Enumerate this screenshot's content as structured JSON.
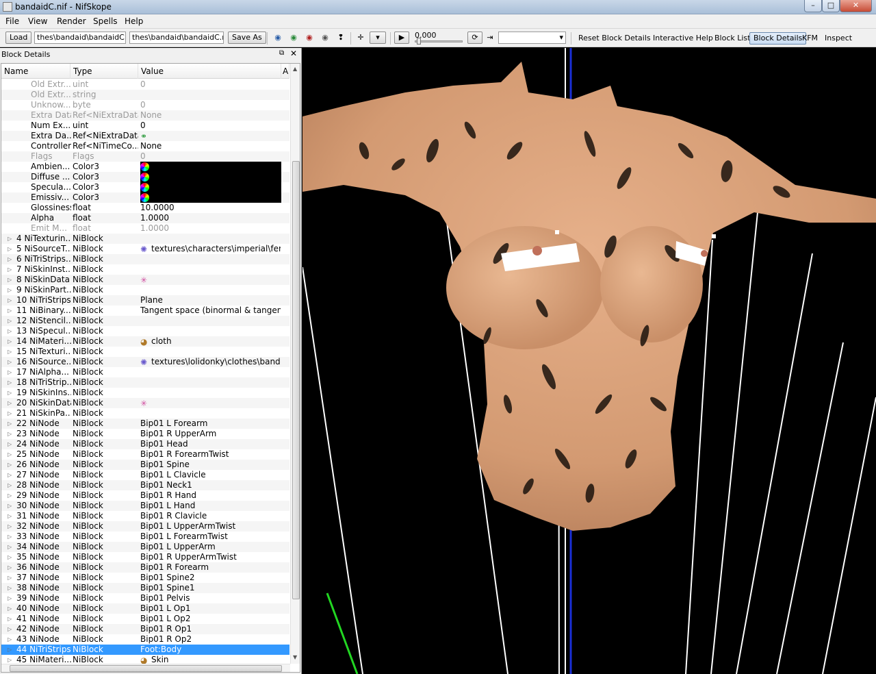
{
  "window": {
    "title": "bandaidC.nif - NifSkope",
    "min": "–",
    "max": "□",
    "close": "✕"
  },
  "menu": [
    "File",
    "View",
    "Render",
    "Spells",
    "Help"
  ],
  "toolbar": {
    "load": "Load",
    "load_path": "thes\\bandaid\\bandaidC.nif",
    "save_path": "thes\\bandaid\\bandaidC.nif",
    "save_as": "Save As",
    "time_value": "0.000",
    "right_buttons": [
      "Reset Block Details",
      "Interactive Help",
      "Block List",
      "Block Details",
      "KFM",
      "Inspect"
    ],
    "active_right": "Block Details"
  },
  "dock": {
    "title": "Block Details",
    "columns": [
      "Name",
      "Type",
      "Value",
      "A"
    ]
  },
  "rows": [
    {
      "name": "Old Extr...",
      "type": "uint",
      "value": "0",
      "kind": "leaf",
      "dim": true
    },
    {
      "name": "Old Extr...",
      "type": "string",
      "value": "",
      "kind": "leaf",
      "dim": true
    },
    {
      "name": "Unknow...",
      "type": "byte",
      "value": "0",
      "kind": "leaf",
      "dim": true
    },
    {
      "name": "Extra Data",
      "type": "Ref<NiExtraData>",
      "value": "None",
      "kind": "leaf",
      "dim": true
    },
    {
      "name": "Num Ex...",
      "type": "uint",
      "value": "0",
      "kind": "leaf"
    },
    {
      "name": "Extra Da...",
      "type": "Ref<NiExtraData>",
      "value": "",
      "kind": "leaf",
      "icon": "link-icon"
    },
    {
      "name": "Controller",
      "type": "Ref<NiTimeCo...",
      "value": "None",
      "kind": "leaf"
    },
    {
      "name": "Flags",
      "type": "Flags",
      "value": "0",
      "kind": "leaf",
      "dim": true
    },
    {
      "name": "Ambien...",
      "type": "Color3",
      "value": "",
      "kind": "leaf",
      "color": true
    },
    {
      "name": "Diffuse ...",
      "type": "Color3",
      "value": "",
      "kind": "leaf",
      "color": true
    },
    {
      "name": "Specula...",
      "type": "Color3",
      "value": "",
      "kind": "leaf",
      "color": true
    },
    {
      "name": "Emissiv...",
      "type": "Color3",
      "value": "",
      "kind": "leaf",
      "color": true
    },
    {
      "name": "Glossiness",
      "type": "float",
      "value": "10.0000",
      "kind": "leaf"
    },
    {
      "name": "Alpha",
      "type": "float",
      "value": "1.0000",
      "kind": "leaf"
    },
    {
      "name": "Emit M...",
      "type": "float",
      "value": "1.0000",
      "kind": "leaf",
      "dim": true
    },
    {
      "name": "4 NiTexturin...",
      "type": "NiBlock",
      "value": "",
      "kind": "block"
    },
    {
      "name": "5 NiSourceT...",
      "type": "NiBlock",
      "value": "textures\\characters\\imperial\\fem...",
      "kind": "block",
      "icon": "texture-icon"
    },
    {
      "name": "6 NiTriStrips...",
      "type": "NiBlock",
      "value": "",
      "kind": "block"
    },
    {
      "name": "7 NiSkinInst...",
      "type": "NiBlock",
      "value": "",
      "kind": "block"
    },
    {
      "name": "8 NiSkinData",
      "type": "NiBlock",
      "value": "",
      "kind": "block",
      "icon": "skin-icon"
    },
    {
      "name": "9 NiSkinPart...",
      "type": "NiBlock",
      "value": "",
      "kind": "block"
    },
    {
      "name": "10 NiTriStrips",
      "type": "NiBlock",
      "value": "Plane",
      "kind": "block"
    },
    {
      "name": "11 NiBinary...",
      "type": "NiBlock",
      "value": "Tangent space (binormal & tangent ...",
      "kind": "block"
    },
    {
      "name": "12 NiStencil...",
      "type": "NiBlock",
      "value": "",
      "kind": "block"
    },
    {
      "name": "13 NiSpecul...",
      "type": "NiBlock",
      "value": "",
      "kind": "block"
    },
    {
      "name": "14 NiMateri...",
      "type": "NiBlock",
      "value": "cloth",
      "kind": "block",
      "icon": "material-icon"
    },
    {
      "name": "15 NiTexturi...",
      "type": "NiBlock",
      "value": "",
      "kind": "block"
    },
    {
      "name": "16 NiSource...",
      "type": "NiBlock",
      "value": "textures\\lolidonky\\clothes\\banda...",
      "kind": "block",
      "icon": "texture-icon"
    },
    {
      "name": "17 NiAlpha...",
      "type": "NiBlock",
      "value": "",
      "kind": "block"
    },
    {
      "name": "18 NiTriStrip...",
      "type": "NiBlock",
      "value": "",
      "kind": "block"
    },
    {
      "name": "19 NiSkinIns...",
      "type": "NiBlock",
      "value": "",
      "kind": "block"
    },
    {
      "name": "20 NiSkinData",
      "type": "NiBlock",
      "value": "",
      "kind": "block",
      "icon": "skin-icon"
    },
    {
      "name": "21 NiSkinPa...",
      "type": "NiBlock",
      "value": "",
      "kind": "block"
    },
    {
      "name": "22 NiNode",
      "type": "NiBlock",
      "value": "Bip01 L Forearm",
      "kind": "block"
    },
    {
      "name": "23 NiNode",
      "type": "NiBlock",
      "value": "Bip01 R UpperArm",
      "kind": "block"
    },
    {
      "name": "24 NiNode",
      "type": "NiBlock",
      "value": "Bip01 Head",
      "kind": "block"
    },
    {
      "name": "25 NiNode",
      "type": "NiBlock",
      "value": "Bip01 R ForearmTwist",
      "kind": "block"
    },
    {
      "name": "26 NiNode",
      "type": "NiBlock",
      "value": "Bip01 Spine",
      "kind": "block"
    },
    {
      "name": "27 NiNode",
      "type": "NiBlock",
      "value": "Bip01 L Clavicle",
      "kind": "block"
    },
    {
      "name": "28 NiNode",
      "type": "NiBlock",
      "value": "Bip01 Neck1",
      "kind": "block"
    },
    {
      "name": "29 NiNode",
      "type": "NiBlock",
      "value": "Bip01 R Hand",
      "kind": "block"
    },
    {
      "name": "30 NiNode",
      "type": "NiBlock",
      "value": "Bip01 L Hand",
      "kind": "block"
    },
    {
      "name": "31 NiNode",
      "type": "NiBlock",
      "value": "Bip01 R Clavicle",
      "kind": "block"
    },
    {
      "name": "32 NiNode",
      "type": "NiBlock",
      "value": "Bip01 L UpperArmTwist",
      "kind": "block"
    },
    {
      "name": "33 NiNode",
      "type": "NiBlock",
      "value": "Bip01 L ForearmTwist",
      "kind": "block"
    },
    {
      "name": "34 NiNode",
      "type": "NiBlock",
      "value": "Bip01 L UpperArm",
      "kind": "block"
    },
    {
      "name": "35 NiNode",
      "type": "NiBlock",
      "value": "Bip01 R UpperArmTwist",
      "kind": "block"
    },
    {
      "name": "36 NiNode",
      "type": "NiBlock",
      "value": "Bip01 R Forearm",
      "kind": "block"
    },
    {
      "name": "37 NiNode",
      "type": "NiBlock",
      "value": "Bip01 Spine2",
      "kind": "block"
    },
    {
      "name": "38 NiNode",
      "type": "NiBlock",
      "value": "Bip01 Spine1",
      "kind": "block"
    },
    {
      "name": "39 NiNode",
      "type": "NiBlock",
      "value": "Bip01 Pelvis",
      "kind": "block"
    },
    {
      "name": "40 NiNode",
      "type": "NiBlock",
      "value": "Bip01 L Op1",
      "kind": "block"
    },
    {
      "name": "41 NiNode",
      "type": "NiBlock",
      "value": "Bip01 L Op2",
      "kind": "block"
    },
    {
      "name": "42 NiNode",
      "type": "NiBlock",
      "value": "Bip01 R Op1",
      "kind": "block"
    },
    {
      "name": "43 NiNode",
      "type": "NiBlock",
      "value": "Bip01 R Op2",
      "kind": "block"
    },
    {
      "name": "44 NiTriStrips",
      "type": "NiBlock",
      "value": "Foot:Body",
      "kind": "block",
      "selected": true
    },
    {
      "name": "45 NiMateri...",
      "type": "NiBlock",
      "value": "Skin",
      "kind": "block",
      "icon": "material-icon"
    }
  ],
  "colors": {
    "selection": "#3399ff",
    "viewport_bg": "#000000",
    "skin": "#d9a07a"
  }
}
